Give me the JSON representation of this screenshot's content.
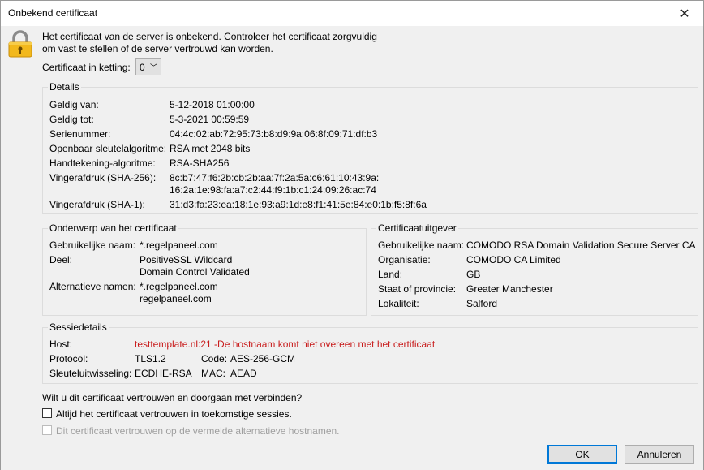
{
  "window": {
    "title": "Onbekend certificaat"
  },
  "intro": {
    "line1": "Het certificaat van de server is onbekend. Controleer het certificaat zorgvuldig",
    "line2": "om vast te stellen of de server vertrouwd kan worden."
  },
  "chain": {
    "label": "Certificaat in ketting:",
    "value": "0"
  },
  "details": {
    "legend": "Details",
    "rows": [
      {
        "label": "Geldig van:",
        "value": "5-12-2018 01:00:00"
      },
      {
        "label": "Geldig tot:",
        "value": "5-3-2021 00:59:59"
      },
      {
        "label": "Serienummer:",
        "value": "04:4c:02:ab:72:95:73:b8:d9:9a:06:8f:09:71:df:b3"
      },
      {
        "label": "Openbaar sleutelalgoritme:",
        "value": "RSA met 2048 bits"
      },
      {
        "label": "Handtekening-algoritme:",
        "value": "RSA-SHA256"
      },
      {
        "label": "Vingerafdruk (SHA-256):",
        "value": "8c:b7:47:f6:2b:cb:2b:aa:7f:2a:5a:c6:61:10:43:9a:",
        "value2": "16:2a:1e:98:fa:a7:c2:44:f9:1b:c1:24:09:26:ac:74"
      },
      {
        "label": "Vingerafdruk (SHA-1):",
        "value": "31:d3:fa:23:ea:18:1e:93:a9:1d:e8:f1:41:5e:84:e0:1b:f5:8f:6a"
      }
    ]
  },
  "subject": {
    "legend": "Onderwerp van het certificaat",
    "common_name_label": "Gebruikelijke naam:",
    "common_name": "*.regelpaneel.com",
    "unit_label": "Deel:",
    "unit1": "PositiveSSL Wildcard",
    "unit2": "Domain Control Validated",
    "alt_label": "Alternatieve namen:",
    "alt1": "*.regelpaneel.com",
    "alt2": "regelpaneel.com"
  },
  "issuer": {
    "legend": "Certificaatuitgever",
    "rows": [
      {
        "label": "Gebruikelijke naam:",
        "value": "COMODO RSA Domain Validation Secure Server CA"
      },
      {
        "label": "Organisatie:",
        "value": "COMODO CA Limited"
      },
      {
        "label": "Land:",
        "value": "GB"
      },
      {
        "label": "Staat of provincie:",
        "value": "Greater Manchester"
      },
      {
        "label": "Lokaliteit:",
        "value": "Salford"
      }
    ]
  },
  "session": {
    "legend": "Sessiedetails",
    "host_label": "Host:",
    "host_value": "testtemplate.nl:21 -De hostnaam komt niet overeen met het certificaat",
    "protocol_label": "Protocol:",
    "protocol_value": "TLS1.2",
    "code_label": "Code:",
    "code_value": "AES-256-GCM",
    "kex_label": "Sleuteluitwisseling:",
    "kex_value": "ECDHE-RSA",
    "mac_label": "MAC:",
    "mac_value": "AEAD"
  },
  "question": "Wilt u dit certificaat vertrouwen en doorgaan met verbinden?",
  "checkbox_always": {
    "label": "Altijd het certificaat vertrouwen in toekomstige sessies.",
    "checked": false
  },
  "checkbox_alt": {
    "label": "Dit certificaat vertrouwen op de vermelde alternatieve hostnamen.",
    "checked": false,
    "disabled": true
  },
  "buttons": {
    "ok": "OK",
    "cancel": "Annuleren"
  },
  "colors": {
    "error": "#c81b1b",
    "accent": "#0078d7",
    "lock_body": "#f2b81c",
    "lock_shackle": "#8a8a8a"
  }
}
